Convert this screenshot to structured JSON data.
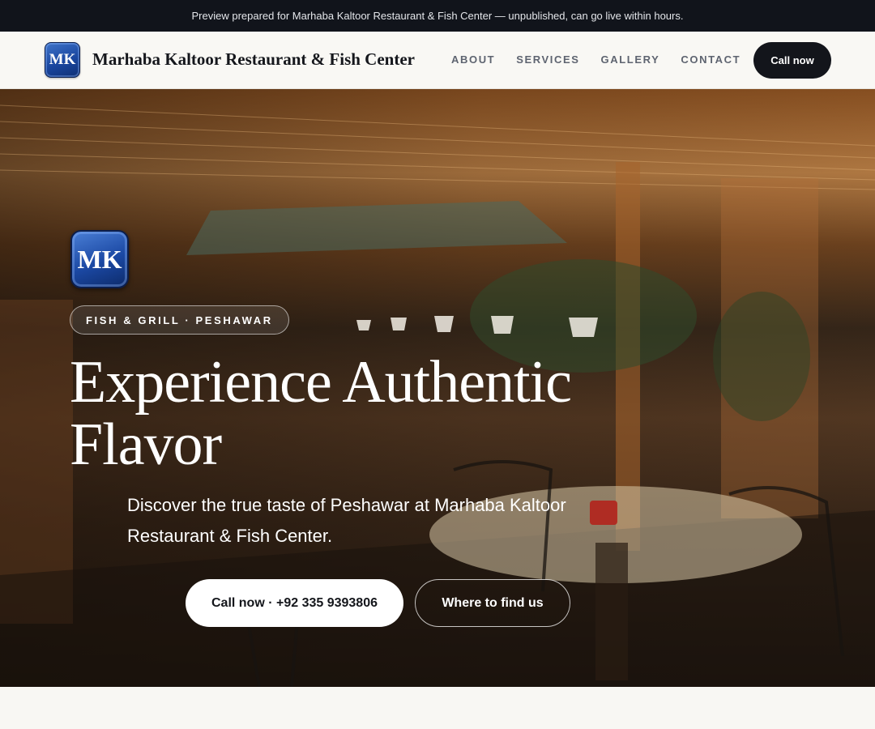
{
  "preview_bar": {
    "text": "Preview prepared for Marhaba Kaltoor Restaurant & Fish Center — unpublished, can go live within hours."
  },
  "nav": {
    "logo_initials": "MK",
    "brand_name": "Marhaba Kaltoor Restaurant & Fish Center",
    "links": [
      "ABOUT",
      "SERVICES",
      "GALLERY",
      "CONTACT"
    ],
    "cta_label": "Call now"
  },
  "hero": {
    "badge_initials": "MK",
    "eyebrow": "FISH & GRILL · PESHAWAR",
    "title_line1": "Experience Authentic",
    "title_line2": "Flavor",
    "subtitle": "Discover the true taste of Peshawar at Marhaba Kaltoor Restaurant & Fish Center.",
    "primary_cta": "Call now · +92 335 9393806",
    "secondary_cta": "Where to find us",
    "background_image": "restaurant-interior-photo"
  },
  "colors": {
    "top_bar": "#11141b",
    "nav_background": "#f9f8f4",
    "cta_dark": "#13151b",
    "badge_blue": "#1a47a0",
    "hero_text": "#ffffff"
  }
}
